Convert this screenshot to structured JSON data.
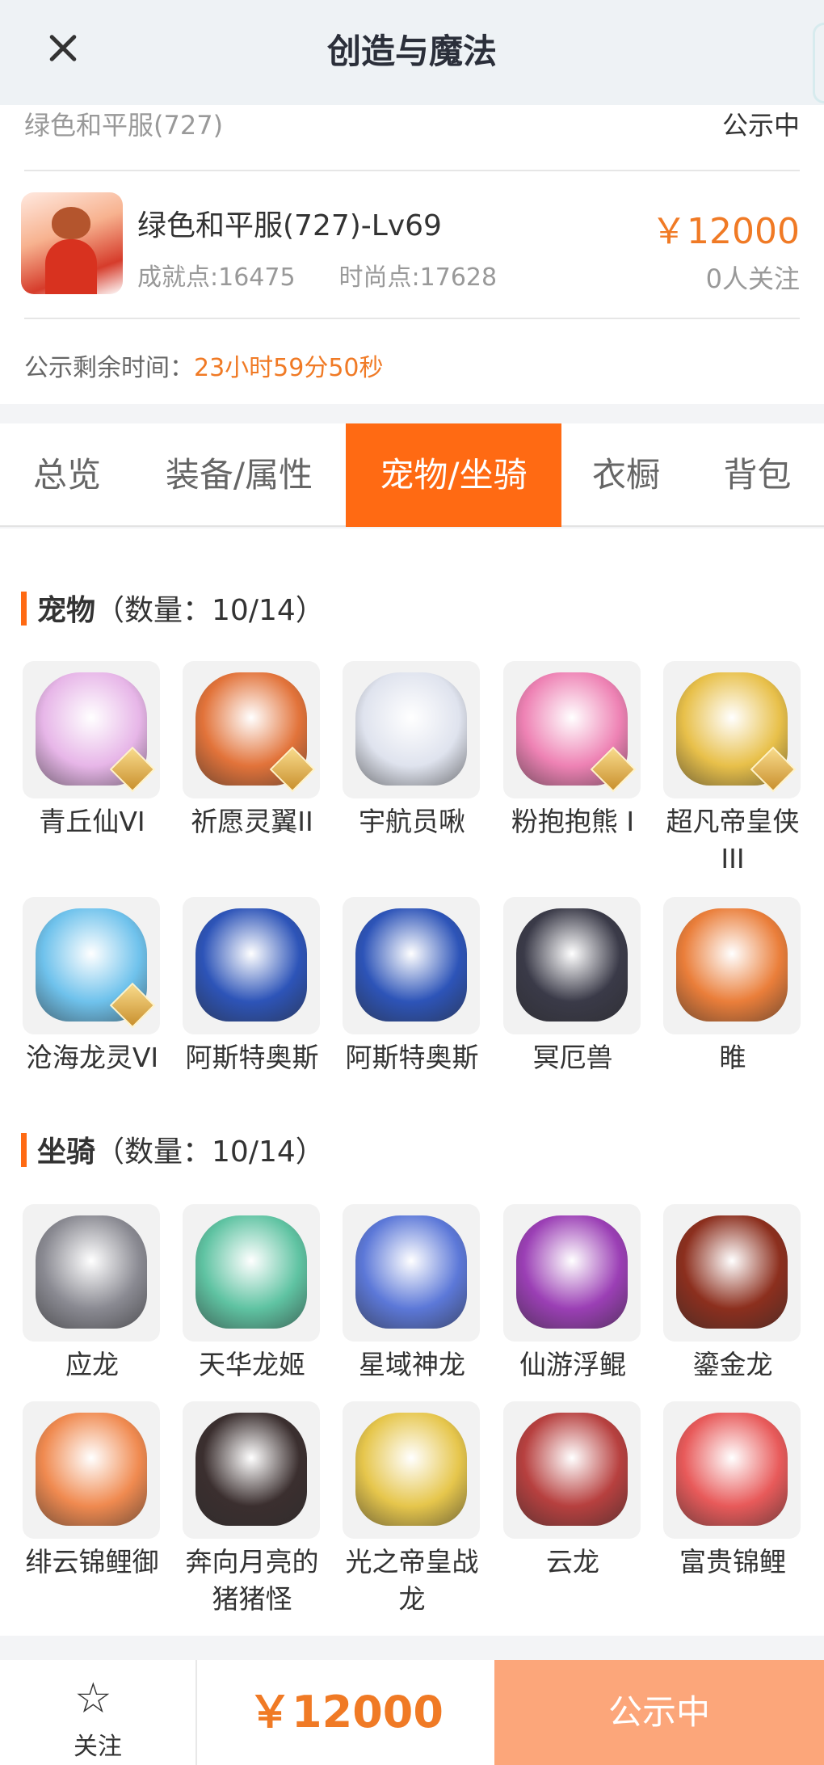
{
  "header": {
    "title": "创造与魔法"
  },
  "listing": {
    "server": "绿色和平服(727)",
    "status": "公示中",
    "character_name": "绿色和平服(727)-Lv69",
    "achievement": "成就点:16475",
    "fashion": "时尚点:17628",
    "price": "￥12000",
    "followers": "0人关注",
    "remaining_label": "公示剩余时间：",
    "remaining_time": "23小时59分50秒"
  },
  "tabs": [
    {
      "label": "总览",
      "active": false
    },
    {
      "label": "装备/属性",
      "active": false
    },
    {
      "label": "宠物/坐骑",
      "active": true
    },
    {
      "label": "衣橱",
      "active": false
    },
    {
      "label": "背包",
      "active": false
    }
  ],
  "pets": {
    "title": "宠物",
    "count": "（数量：10/14）",
    "items": [
      {
        "name": "青丘仙VI",
        "icon": "pet-qingqiu-icon",
        "color": "#e7b6e8"
      },
      {
        "name": "祈愿灵翼II",
        "icon": "pet-lingyi-icon",
        "color": "#e2733a"
      },
      {
        "name": "宇航员啾",
        "icon": "pet-astronaut-icon",
        "color": "#dfe3ee"
      },
      {
        "name": "粉抱抱熊 I",
        "icon": "pet-pink-bear-icon",
        "color": "#ee82b4"
      },
      {
        "name": "超凡帝皇侠III",
        "icon": "pet-emperor-icon",
        "color": "#e8c04a"
      },
      {
        "name": "沧海龙灵VI",
        "icon": "pet-canghai-icon",
        "color": "#6fc2ec"
      },
      {
        "name": "阿斯特奥斯",
        "icon": "pet-asteros-icon",
        "color": "#2d54b8"
      },
      {
        "name": "阿斯特奥斯",
        "icon": "pet-asteros-icon",
        "color": "#2d54b8"
      },
      {
        "name": "冥厄兽",
        "icon": "pet-mingesho-icon",
        "color": "#3a3a48"
      },
      {
        "name": "睢",
        "icon": "pet-sui-icon",
        "color": "#ea7e3a"
      }
    ]
  },
  "mounts": {
    "title": "坐骑",
    "count": "（数量：10/14）",
    "items": [
      {
        "name": "应龙",
        "icon": "mount-yinglong-icon",
        "color": "#8a8a92"
      },
      {
        "name": "天华龙姬",
        "icon": "mount-tianhua-icon",
        "color": "#5fc3a2"
      },
      {
        "name": "星域神龙",
        "icon": "mount-xingyu-icon",
        "color": "#5c78d8"
      },
      {
        "name": "仙游浮鲲",
        "icon": "mount-fukun-icon",
        "color": "#9b3fb5"
      },
      {
        "name": "鎏金龙",
        "icon": "mount-liujin-icon",
        "color": "#8c2f1e"
      },
      {
        "name": "绯云锦鲤御",
        "icon": "mount-feiyun-icon",
        "color": "#f08a50"
      },
      {
        "name": "奔向月亮的猪猪怪",
        "icon": "mount-pig-icon",
        "color": "#3b2f2f"
      },
      {
        "name": "光之帝皇战龙",
        "icon": "mount-light-dragon-icon",
        "color": "#e6c64c"
      },
      {
        "name": "云龙",
        "icon": "mount-yunlong-icon",
        "color": "#b7403f"
      },
      {
        "name": "富贵锦鲤",
        "icon": "mount-koi-icon",
        "color": "#e85a5a"
      }
    ]
  },
  "bottom_bar": {
    "follow_label": "关注",
    "price": "￥12000",
    "status_button": "公示中"
  }
}
